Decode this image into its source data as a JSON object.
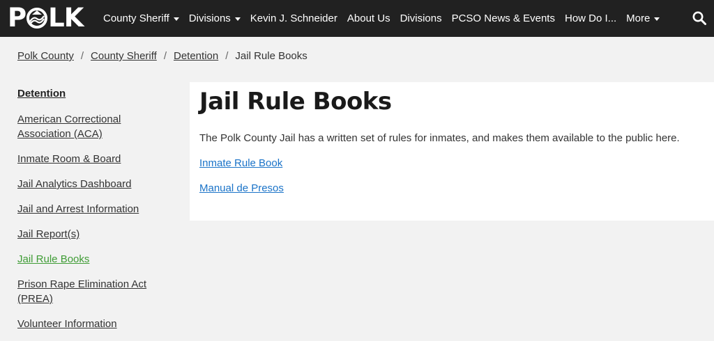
{
  "header": {
    "logo_text_left": "P",
    "logo_text_right": "LK",
    "nav_items": [
      {
        "label": "County Sheriff",
        "has_dropdown": true
      },
      {
        "label": "Divisions",
        "has_dropdown": true
      },
      {
        "label": "Kevin J. Schneider",
        "has_dropdown": false
      },
      {
        "label": "About Us",
        "has_dropdown": false
      },
      {
        "label": "Divisions",
        "has_dropdown": false
      },
      {
        "label": "PCSO News & Events",
        "has_dropdown": false
      },
      {
        "label": "How Do I...",
        "has_dropdown": false
      },
      {
        "label": "More",
        "has_dropdown": true
      }
    ],
    "search_icon": "search-icon"
  },
  "breadcrumb": {
    "items": [
      "Polk County",
      "County Sheriff",
      "Detention"
    ],
    "current": "Jail Rule Books",
    "separator": "/"
  },
  "sidebar": {
    "heading": "Detention",
    "items": [
      {
        "label": "American Correctional Association (ACA)",
        "active": false
      },
      {
        "label": "Inmate Room & Board",
        "active": false
      },
      {
        "label": "Jail Analytics Dashboard",
        "active": false
      },
      {
        "label": "Jail and Arrest Information",
        "active": false
      },
      {
        "label": "Jail Report(s)",
        "active": false
      },
      {
        "label": "Jail Rule Books",
        "active": true
      },
      {
        "label": "Prison Rape Elimination Act (PREA)",
        "active": false
      },
      {
        "label": "Volunteer Information",
        "active": false
      }
    ]
  },
  "main": {
    "title": "Jail Rule Books",
    "intro": "The Polk County Jail has a written set of rules for inmates, and makes them available to the public here.",
    "links": [
      "Inmate Rule Book",
      "Manual de Presos"
    ]
  },
  "colors": {
    "nav_bg": "#212121",
    "page_bg": "#f2f2f2",
    "link_blue": "#1a73c8",
    "active_green": "#3f9c35"
  }
}
